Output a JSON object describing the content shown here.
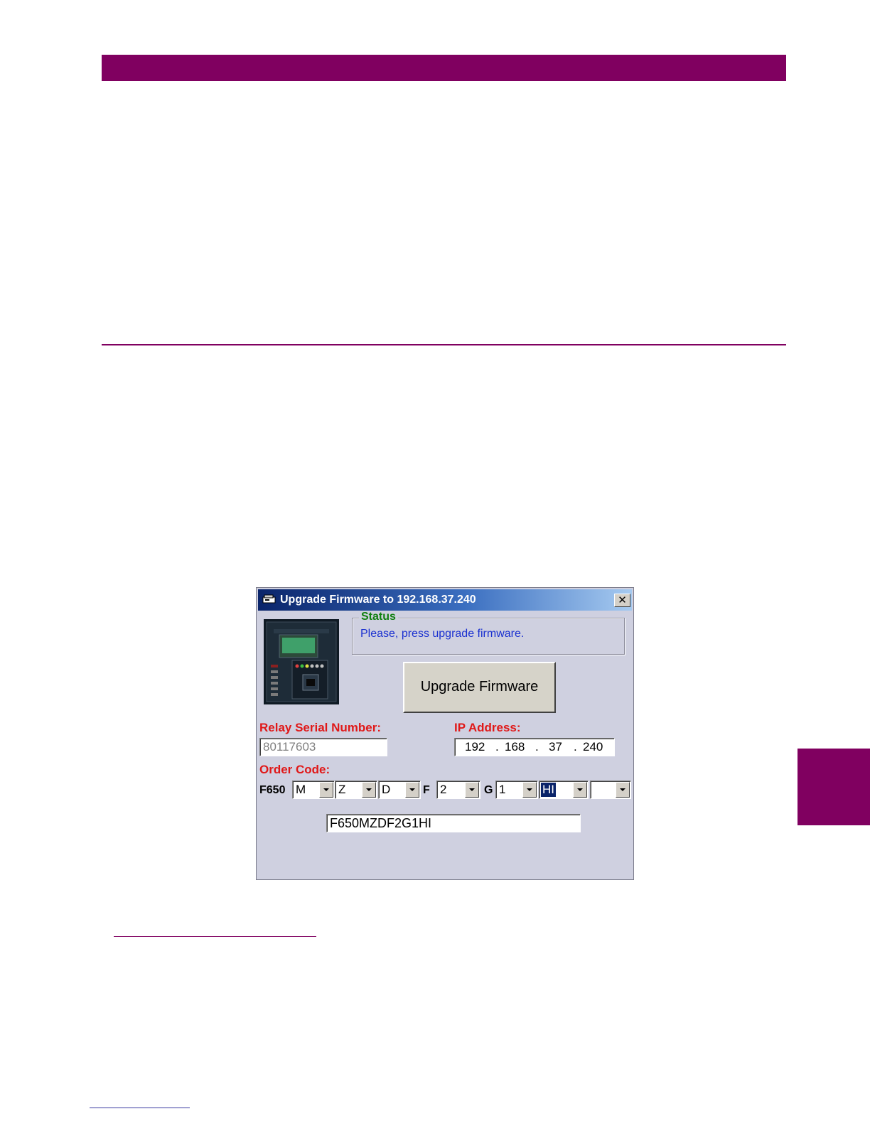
{
  "dialog": {
    "title": "Upgrade Firmware to 192.168.37.240",
    "close_label": "✕",
    "status": {
      "legend": "Status",
      "message": "Please, press upgrade firmware."
    },
    "upgrade_button_label": "Upgrade Firmware",
    "serial_label": "Relay Serial Number:",
    "serial_value": "80117603",
    "ip_label": "IP Address:",
    "ip_octets": [
      "192",
      "168",
      "37",
      "240"
    ],
    "ip_dot": ".",
    "order_code_label": "Order Code:",
    "order_code": {
      "prefix": "F650",
      "fixed_f": "F",
      "fixed_g": "G",
      "combo_values": [
        "M",
        "Z",
        "D",
        "2",
        "1",
        "HI",
        ""
      ],
      "selected_combo": "HI",
      "result": "F650MZDF2G1HI"
    }
  },
  "colors": {
    "brand": "#800060",
    "titlebar_start": "#0a246a",
    "status_legend": "#108010",
    "status_message": "#1a30d0",
    "label_red": "#e01818",
    "dialog_bg": "#cfd0e0"
  }
}
